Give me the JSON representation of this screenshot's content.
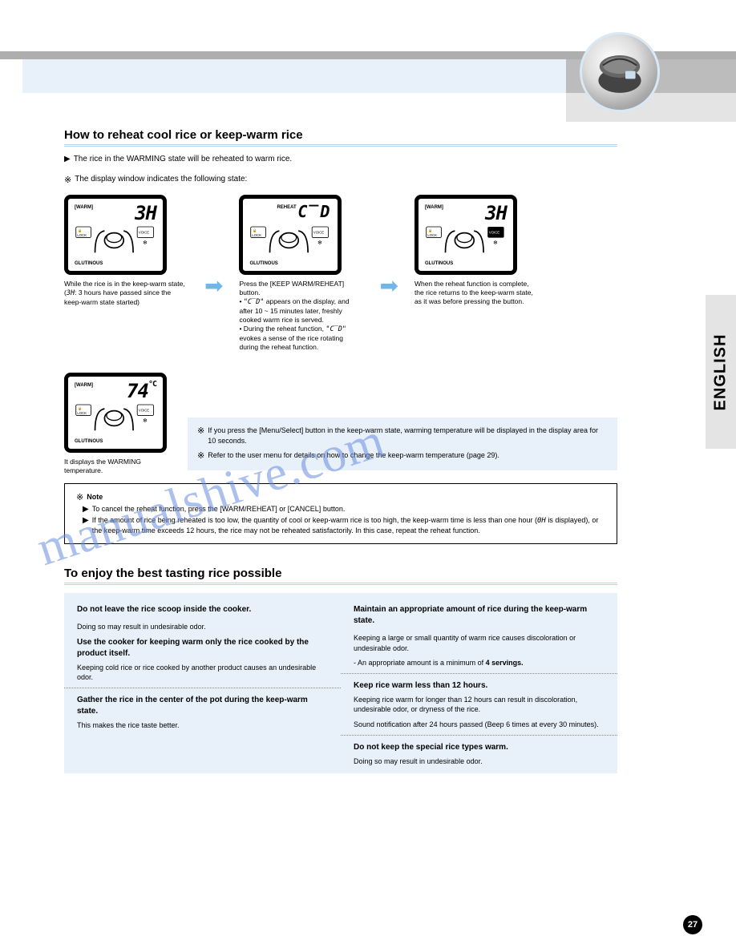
{
  "header": {
    "side_tab": "ENGLISH"
  },
  "section1": {
    "title": "How to reheat cool rice or keep-warm rice",
    "intro": "The rice in the WARMING state will be reheated to warm rice.",
    "dispnote": "The display window indicates the following state:"
  },
  "panels": {
    "a": {
      "warm": "[WARM]",
      "big": "3H",
      "glut": "GLUTINOUS",
      "cap1": "While the rice is in the keep-warm state,",
      "cap2_a": "(",
      "cap2_b": ": 3 hours have passed since the keep-warm state started)"
    },
    "b": {
      "reh": "REHEAT",
      "big": "C‾D",
      "glut": "GLUTINOUS",
      "cap1": "Press the [KEEP WARM/REHEAT] button.",
      "bullet1_pre": "• ",
      "bullet1": " appears on the display, and after 10 ~ 15 minutes later, freshly cooked warm rice is served.",
      "bullet1_sym": "\"C‾D\"",
      "bullet2_pre": "• During the reheat function, ",
      "bullet2_sym": "\"C‾D\"",
      "bullet2_post": " evokes a sense of the rice rotating during the reheat function."
    },
    "c": {
      "warm": "[WARM]",
      "big": "3H",
      "glut": "GLUTINOUS",
      "cap": "When the reheat function is complete, the rice returns to the keep-warm state, as it was before pressing the button."
    },
    "d": {
      "warm": "[WARM]",
      "big": "74",
      "unit": "°C",
      "glut": "GLUTINOUS",
      "cap": "It displays the WARMING temperature."
    }
  },
  "tempbox": {
    "l1": "If you press the [Menu/Select] button in the keep-warm state, warming temperature will be displayed in the display area for 10 seconds.",
    "l2": "Refer to the user menu for details on how to change the keep-warm temperature (page 29)."
  },
  "notebox": {
    "head": "Note",
    "n1": "To cancel the reheat function, press the [WARM/REHEAT] or [CANCEL] button.",
    "n2_a": "If the amount of rice being reheated is too low, the quantity of cool or keep-warm rice is too high, the keep-warm time is less than one hour (",
    "n2_sym": "0H",
    "n2_b": " is displayed), or the keep-warm time exceeds 12 hours, the rice may not be reheated satisfactorily. In this case, repeat the reheat function."
  },
  "section2": {
    "title": "To enjoy the best tasting rice possible",
    "cols": {
      "l1h": "Do not leave the rice scoop inside the cooker.",
      "l1p": "Doing so may result in undesirable odor.",
      "l2h": "Use the cooker for keeping warm only the rice cooked by the product itself.",
      "l2p": "Keeping cold rice or rice cooked by another product causes an undesirable odor.",
      "l3h": "Gather the rice in the center of the pot during the keep-warm state.",
      "l3p": "This makes the rice taste better.",
      "r1h": "Maintain an appropriate amount of rice during the keep-warm state.",
      "r1p1": "Keeping a large or small quantity of warm rice causes discoloration or undesirable odor.",
      "r1p2_pre": "- An appropriate amount is a minimum of ",
      "r1p2_qty": "4 servings.",
      "r2h": "Keep rice warm less than 12 hours.",
      "r2p1": "Keeping rice warm for longer than 12 hours can result in discoloration, undesirable odor, or dryness of the rice.",
      "r2p2": "Sound notification after 24 hours passed (Beep 6 times at every 30 minutes).",
      "r3h": "Do not keep the special rice types warm.",
      "r3p": "Doing so may result in undesirable odor."
    }
  },
  "pagenum": "27",
  "watermark": "manualshive.com",
  "lcd_labels": {
    "lock": "LOCK",
    "voice": "VOICE"
  }
}
